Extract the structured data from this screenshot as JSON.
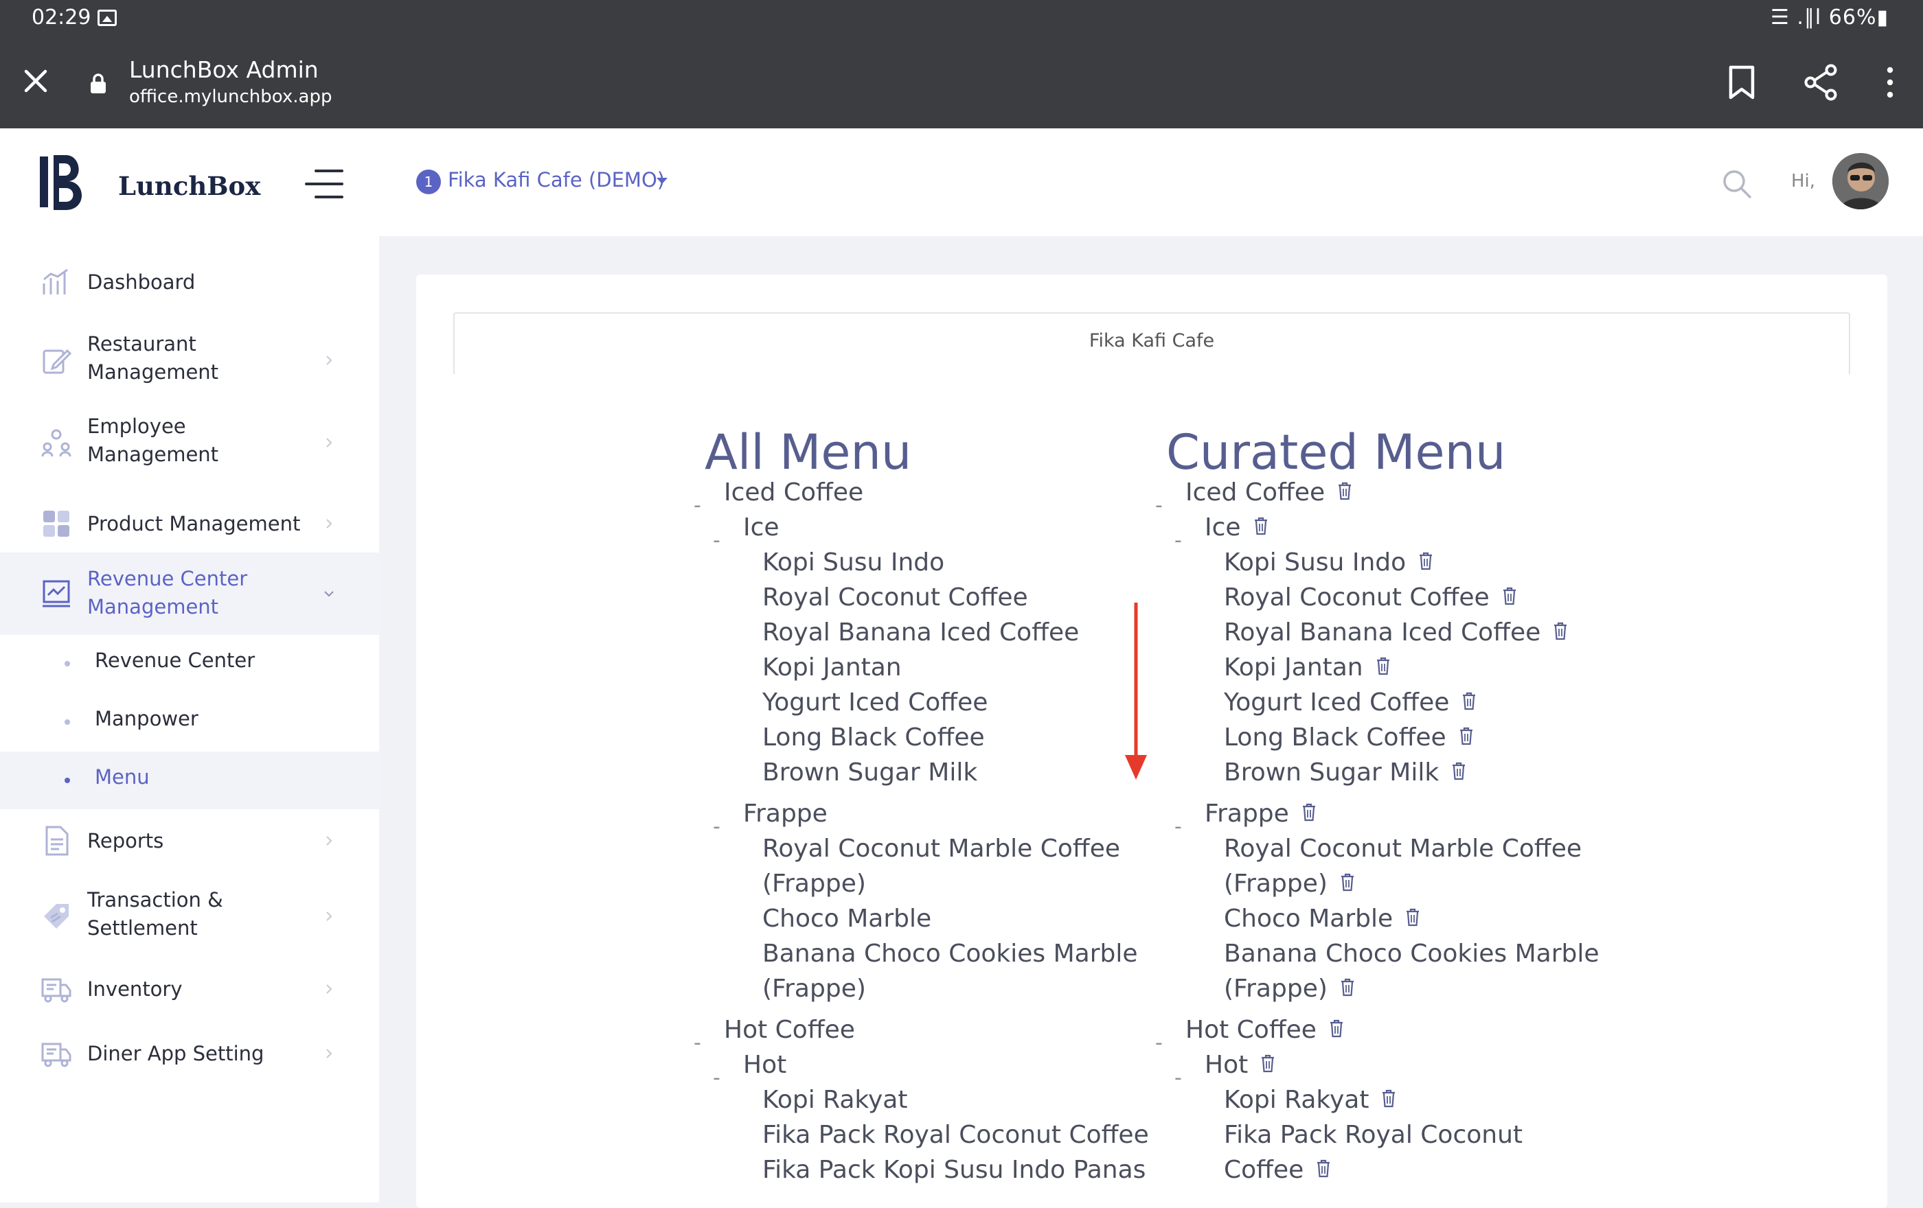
{
  "status_bar": {
    "time": "02:29",
    "right": "☰ .∥l 66%▮"
  },
  "browser": {
    "title": "LunchBox Admin",
    "url": "office.mylunchbox.app"
  },
  "brand": {
    "name": "LunchBox"
  },
  "sidebar": {
    "items": [
      {
        "label": "Dashboard"
      },
      {
        "label": "Restaurant Management"
      },
      {
        "label": "Employee Management"
      },
      {
        "label": "Product Management"
      },
      {
        "label": "Revenue Center Management"
      },
      {
        "label": "Reports"
      },
      {
        "label": "Transaction & Settlement"
      },
      {
        "label": "Inventory"
      },
      {
        "label": "Diner App Setting"
      }
    ],
    "sub_items": [
      {
        "label": "Revenue Center"
      },
      {
        "label": "Manpower"
      },
      {
        "label": "Menu"
      }
    ]
  },
  "header": {
    "store_index": "1",
    "store_name": "Fika Kafi Cafe (DEMO)",
    "greeting": "Hi,"
  },
  "tab": {
    "label": "Fika Kafi Cafe"
  },
  "all_menu": {
    "title": "All Menu",
    "lines": [
      "Iced Coffee",
      "Ice",
      "Kopi Susu Indo",
      "Royal Coconut Coffee",
      "Royal Banana Iced Coffee",
      "Kopi Jantan",
      "Yogurt Iced Coffee",
      "Long Black Coffee",
      "Brown Sugar Milk",
      "Frappe",
      "Royal Coconut Marble Coffee",
      "(Frappe)",
      "Choco Marble",
      "Banana Choco Cookies Marble",
      "(Frappe)",
      "Hot Coffee",
      "Hot",
      "Kopi Rakyat",
      "Fika Pack Royal Coconut Coffee",
      "Fika Pack Kopi Susu Indo Panas"
    ]
  },
  "curated_menu": {
    "title": "Curated Menu",
    "lines": [
      "Iced Coffee",
      "Ice",
      "Kopi Susu Indo",
      "Royal Coconut Coffee",
      "Royal Banana Iced Coffee",
      "Kopi Jantan",
      "Yogurt Iced Coffee",
      "Long Black Coffee",
      "Brown Sugar Milk",
      "Frappe",
      "Royal Coconut Marble Coffee",
      "(Frappe)",
      "Choco Marble",
      "Banana Choco Cookies Marble",
      "(Frappe)",
      "Hot Coffee",
      "Hot",
      "Kopi Rakyat",
      "Fika Pack Royal Coconut",
      "Coffee"
    ]
  },
  "colors": {
    "accent": "#5b63c4",
    "title": "#575e8f",
    "arrow": "#e53a2b",
    "bars": "#3c3d40"
  }
}
